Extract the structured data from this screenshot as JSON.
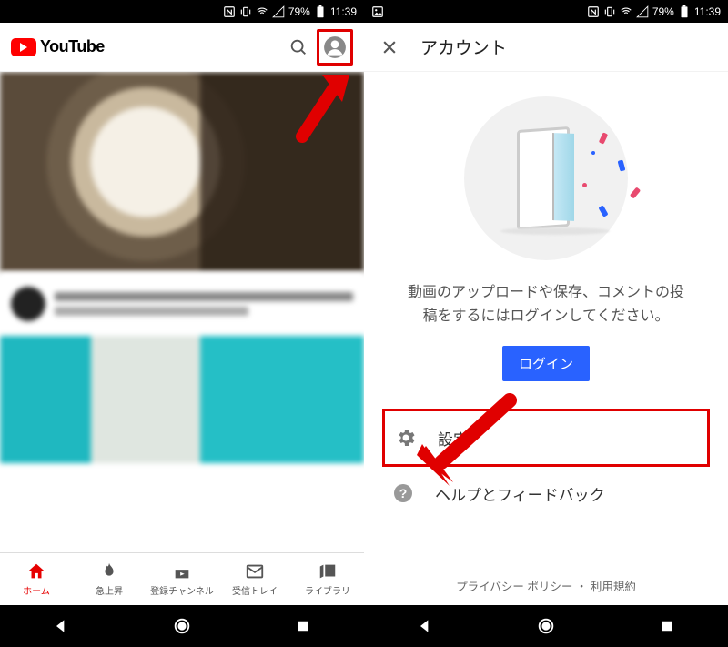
{
  "status": {
    "battery_pct": "79%",
    "time": "11:39"
  },
  "left": {
    "app_name": "YouTube",
    "tabs": [
      {
        "label": "ホーム",
        "active": true
      },
      {
        "label": "急上昇",
        "active": false
      },
      {
        "label": "登録チャンネル",
        "active": false
      },
      {
        "label": "受信トレイ",
        "active": false
      },
      {
        "label": "ライブラリ",
        "active": false
      }
    ]
  },
  "right": {
    "header_title": "アカウント",
    "signin_prompt": "動画のアップロードや保存、コメントの投稿をするにはログインしてください。",
    "login_button": "ログイン",
    "menu": {
      "settings": "設定",
      "help": "ヘルプとフィードバック"
    },
    "footer": "プライバシー ポリシー ・ 利用規約"
  }
}
